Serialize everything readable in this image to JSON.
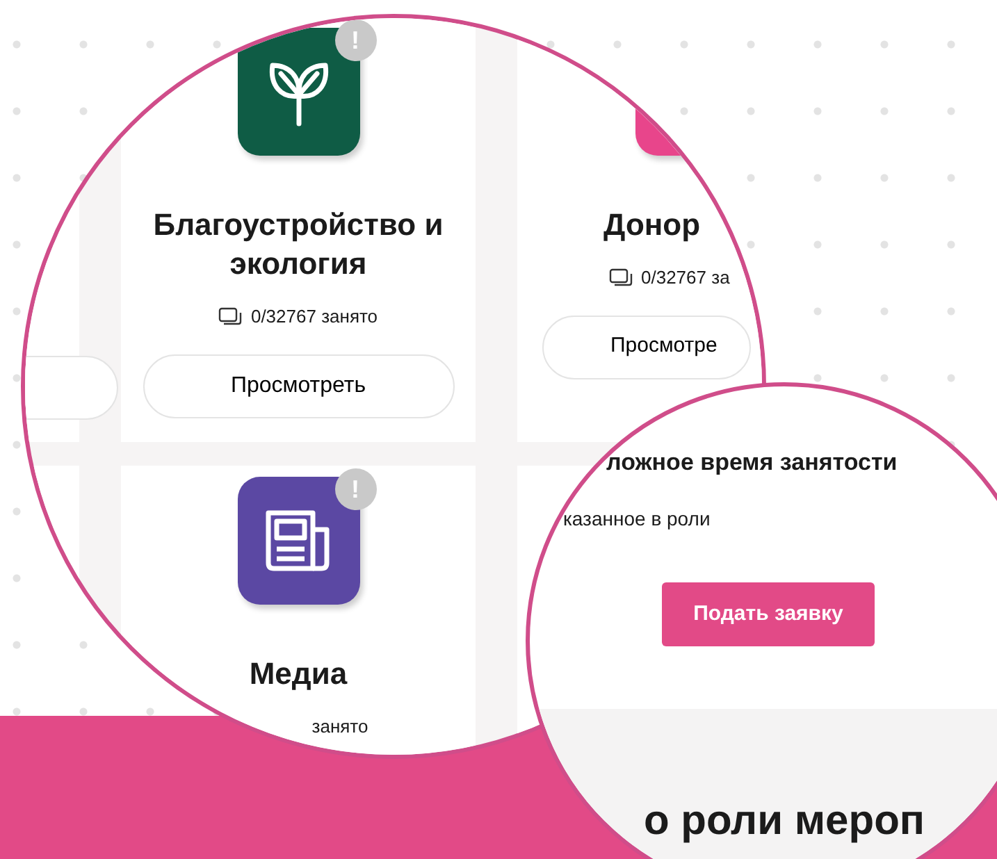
{
  "zoom_left": {
    "cards": [
      {
        "kind": "edge"
      },
      {
        "kind": "sprout",
        "color": "#0f5c45",
        "alert": "!",
        "title": "Благоустройство и экология",
        "stat": "0/32767 занято",
        "button": "Просмотреть"
      },
      {
        "kind": "blob",
        "color": "#e8458b",
        "title": "Донор",
        "stat": "0/32767 за",
        "button": "Просмотре"
      },
      {
        "kind": "blank"
      },
      {
        "kind": "newspaper",
        "color": "#5b48a3",
        "alert": "!",
        "title": "Медиа",
        "stat": "занято"
      },
      {
        "kind": "blank"
      }
    ]
  },
  "zoom_right": {
    "heading": "ложное время занятости",
    "text": "казанное в роли",
    "button": "Подать заявку",
    "section_title": "о роли мероп"
  }
}
